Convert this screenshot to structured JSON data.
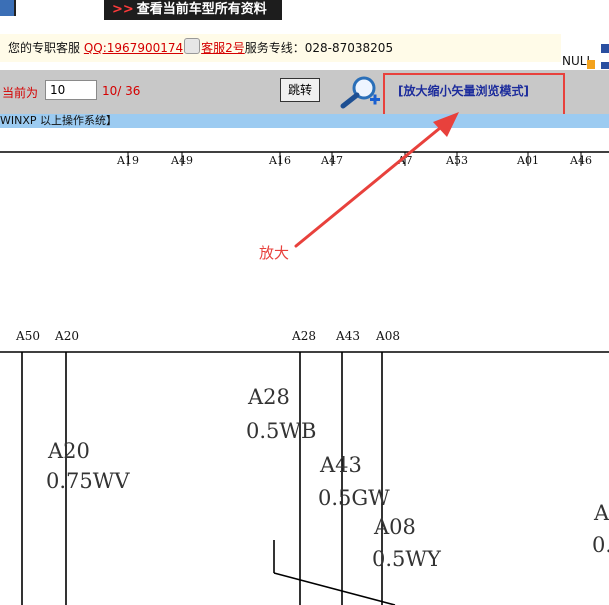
{
  "header": {
    "view_all_label": "查看当前车型所有资料"
  },
  "service_bar": {
    "prefix": "您的专职客服",
    "qq_link": "QQ:1967900174",
    "agent_link": "客服2号",
    "hotline": "服务专线：028-87038205"
  },
  "corner": {
    "null_text": "NULL"
  },
  "nav": {
    "page_label": "当前为",
    "page_value": "10",
    "page_count": "10/ 36",
    "jump_button": "跳转",
    "vector_mode_link": "[放大缩小矢量浏览模式]"
  },
  "os_bar": {
    "text": "WINXP 以上操作系统】"
  },
  "annotation": {
    "text": "放大",
    "color": "#e8413c"
  },
  "diagram": {
    "top_pins": [
      "A19",
      "A49",
      "A16",
      "A47",
      "A7",
      "A53",
      "A01",
      "A46"
    ],
    "mid_pins": [
      "A50",
      "A20",
      "A28",
      "A43",
      "A08"
    ],
    "wire_labels": [
      {
        "code": "A28",
        "spec": "0.5WB"
      },
      {
        "code": "A20",
        "spec": "0.75WV"
      },
      {
        "code": "A43",
        "spec": "0.5GW"
      },
      {
        "code": "A08",
        "spec": "0.5WY"
      }
    ],
    "edge_labels": [
      "A",
      "0."
    ]
  }
}
